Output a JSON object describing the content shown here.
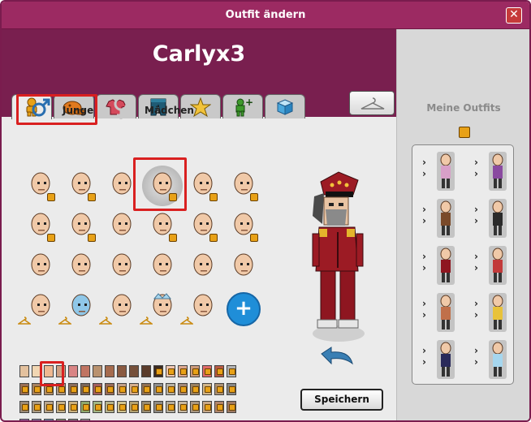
{
  "window": {
    "title": "Outfit ändern",
    "close_label": "✕"
  },
  "header": {
    "username": "Carlyx3"
  },
  "tabs": [
    {
      "id": "body",
      "icon": "body-icon",
      "active": true
    },
    {
      "id": "hats",
      "icon": "hat-icon",
      "active": false
    },
    {
      "id": "shirts",
      "icon": "shirt-icon",
      "active": false
    },
    {
      "id": "pants",
      "icon": "pants-icon",
      "active": false
    },
    {
      "id": "effects",
      "icon": "star-icon",
      "active": false
    },
    {
      "id": "pets",
      "icon": "figure-plus-icon",
      "active": false
    },
    {
      "id": "cube",
      "icon": "cube-icon",
      "active": false
    }
  ],
  "hanger_button": {
    "icon": "hanger-icon"
  },
  "gender": {
    "male_label": "Junge",
    "female_label": "Mädchen",
    "selected": "male"
  },
  "faces": {
    "rows": [
      [
        "face",
        "face",
        "face",
        "face-selected",
        "face",
        "face"
      ],
      [
        "face",
        "face",
        "face",
        "face",
        "face",
        "face"
      ],
      [
        "face",
        "face",
        "face",
        "face",
        "face",
        "face"
      ],
      [
        "face-hc",
        "ice-head-hc",
        "face-hc",
        "crown-head-hc",
        "face-hc",
        "add"
      ]
    ],
    "selected_index": 3
  },
  "swatches": {
    "rows": [
      [
        "#e3c19e",
        "#f1d6b3",
        "#efb891",
        "#cf9e81",
        "#d98585",
        "#c07462",
        "#b9926f",
        "#a56b4e",
        "#8a5a41",
        "#76503a",
        "#5b3c2b",
        "#3b2a22",
        "#f0c7b2",
        "#dda890",
        "#cc9a7b",
        "#e06a6a",
        "#b65a45",
        "#b3b3b3"
      ],
      [
        "#9a6f56",
        "#a7815f",
        "#b28d64",
        "#ae9a87",
        "#8c6f5e",
        "#7b6659",
        "#a25f5f",
        "#986c5c",
        "#c2a08a",
        "#d5ae8d",
        "#917154",
        "#8e8e8e",
        "#b8b2a6",
        "#a2887a",
        "#998060",
        "#d0b489",
        "#ad9174",
        "#878787"
      ],
      [
        "#9b8a77",
        "#aa9b85",
        "#b9a78e",
        "#c2b18f",
        "#c9b07f",
        "#8fa86d",
        "#a2b685",
        "#b5b38d",
        "#d0c390",
        "#b2a171",
        "#998c72",
        "#8f8b84",
        "#b4ad9e",
        "#c6b8a2",
        "#a99781",
        "#c7a888",
        "#b2876b",
        "#9e7a64"
      ],
      [
        "#9c6fae",
        "#8b84b0",
        "#6d91b5",
        "#8da37c",
        "#8a8a8a",
        "#a1a1a1"
      ]
    ],
    "selected": [
      0,
      2
    ]
  },
  "save_button": {
    "label": "Speichern"
  },
  "outfits": {
    "title": "Meine Outfits",
    "rows": 5
  },
  "colors": {
    "title_bar": "#9c2a62",
    "header_band": "#791f4f",
    "highlight": "#d92020",
    "add_button": "#1f8ed8"
  }
}
